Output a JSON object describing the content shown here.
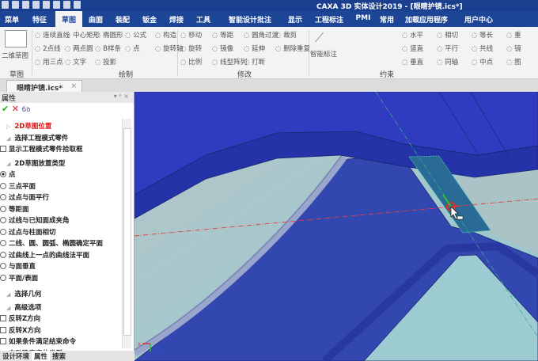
{
  "window": {
    "title": "CAXA 3D 实体设计2019 - [眼睛护镜.ics*]"
  },
  "tabs": [
    "菜单",
    "特征",
    "草图",
    "曲面",
    "装配",
    "钣金",
    "焊接",
    "工具",
    "智能设计批注",
    "显示",
    "工程标注",
    "PMI",
    "常用",
    "加载应用程序",
    "用户中心"
  ],
  "active_tab": "草图",
  "ribbon": {
    "sketch_group": {
      "button": "二维草图",
      "label": "草图"
    },
    "draw_group": {
      "label": "绘制",
      "items": [
        "连续直线",
        "中心矩形",
        "椭圆形",
        "公式",
        "构造",
        "2点线",
        "两点圆",
        "B样条",
        "点",
        "旋转轴",
        "用三点",
        "文字",
        "投影"
      ]
    },
    "modify_group": {
      "label": "修改",
      "items": [
        "移动",
        "等距",
        "圆角过渡",
        "裁剪",
        "旋转",
        "镜像",
        "延伸",
        "删除重复",
        "比例",
        "线型阵列",
        "打断"
      ]
    },
    "constraint_group": {
      "label": "约束",
      "button": "智能标注",
      "items": [
        "水平",
        "相切",
        "等长",
        "重",
        "竖直",
        "平行",
        "共线",
        "镜",
        "垂直",
        "同轴",
        "中点",
        "图"
      ]
    }
  },
  "document_tab": {
    "label": "眼睛护镜.ics*",
    "close": "×"
  },
  "panel": {
    "title": "属性",
    "sections": {
      "position": "2D草图位置",
      "select_part": "选择工程模式零件",
      "place_type": "2D草图放置类型",
      "select_geom": "选择几何",
      "advanced": "高级选项"
    },
    "show_pick_box": "显示工程模式零件拾取框",
    "place_options": [
      "点",
      "三点平面",
      "过点与面平行",
      "等距面",
      "过线与已知面成夹角",
      "过点与柱面相切",
      "二线、圆、圆弧、椭圆确定平面",
      "过曲线上一点的曲线法平面",
      "与面垂直",
      "平面/表面"
    ],
    "selected_option": "点",
    "advanced_options": [
      {
        "label": "反转Z方向",
        "checked": false
      },
      {
        "label": "反转X方向",
        "checked": false
      },
      {
        "label": "如果条件满足结束命令",
        "checked": false
      },
      {
        "label": "自动确定定位类型",
        "checked": true
      }
    ],
    "bottom_tabs": [
      "设计环境",
      "属性",
      "搜索"
    ],
    "active_bottom_tab": "属性"
  },
  "viewport": {
    "axis_labels": {
      "x": "X",
      "y": "Y",
      "z": "Z"
    },
    "colors": {
      "part": "#3040b8",
      "highlight": "#2a6a96",
      "background": "#a9c3c6"
    }
  }
}
